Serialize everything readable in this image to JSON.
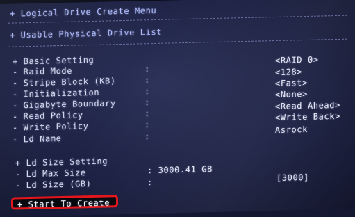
{
  "menu": {
    "title": "+ Logical Drive Create Menu",
    "usable_list": "+ Usable Physical Drive List"
  },
  "basic_setting": {
    "header": "+ Basic Setting",
    "separator": ":",
    "rows": [
      {
        "label": "- Raid Mode",
        "value": "<RAID 0>"
      },
      {
        "label": "- Stripe Block (KB)",
        "value": "<128>"
      },
      {
        "label": "- Initialization",
        "value": "<Fast>"
      },
      {
        "label": "- Gigabyte Boundary",
        "value": "<None>"
      },
      {
        "label": "- Read Policy",
        "value": "<Read Ahead>"
      },
      {
        "label": "- Write Policy",
        "value": "<Write Back>"
      },
      {
        "label": "- Ld Name",
        "value": "Asrock"
      }
    ]
  },
  "ld_size_setting": {
    "header": "+ Ld Size Setting",
    "max_label": "- Ld Max Size",
    "max_value": ": 3000.41 GB",
    "size_label": "- Ld Size (GB)",
    "size_sep": ":",
    "size_value": "[3000]"
  },
  "actions": {
    "start_label": "+ Start To Create"
  },
  "colors": {
    "background": "#1c2143",
    "highlight_border": "#e3141b",
    "title_text": "#aebaff"
  }
}
